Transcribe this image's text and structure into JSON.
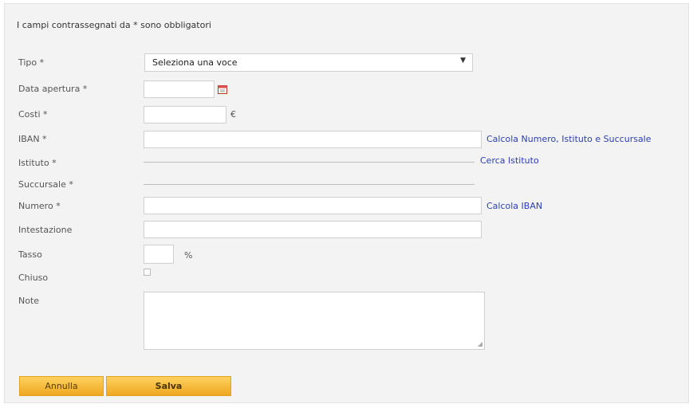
{
  "form": {
    "required_note": "I campi contrassegnati da * sono obbligatori",
    "fields": {
      "tipo": {
        "label": "Tipo *",
        "value": "Seleziona una voce"
      },
      "data_apertura": {
        "label": "Data apertura *"
      },
      "costi": {
        "label": "Costi *",
        "unit": "€"
      },
      "iban": {
        "label": "IBAN *",
        "link": "Calcola Numero, Istituto e Succursale"
      },
      "istituto": {
        "label": "Istituto *",
        "link": "Cerca Istituto"
      },
      "succursale": {
        "label": "Succursale *"
      },
      "numero": {
        "label": "Numero *",
        "link": "Calcola IBAN"
      },
      "intestazione": {
        "label": "Intestazione"
      },
      "tasso": {
        "label": "Tasso",
        "unit": "%"
      },
      "chiuso": {
        "label": "Chiuso",
        "checked": false
      },
      "note": {
        "label": "Note"
      }
    },
    "buttons": {
      "cancel": "Annulla",
      "save": "Salva"
    },
    "icons": {
      "calendar": "calendar-icon",
      "dropdown": "chevron-down-icon"
    },
    "colors": {
      "link": "#2a3fb5",
      "button": "#f5b83a"
    }
  }
}
